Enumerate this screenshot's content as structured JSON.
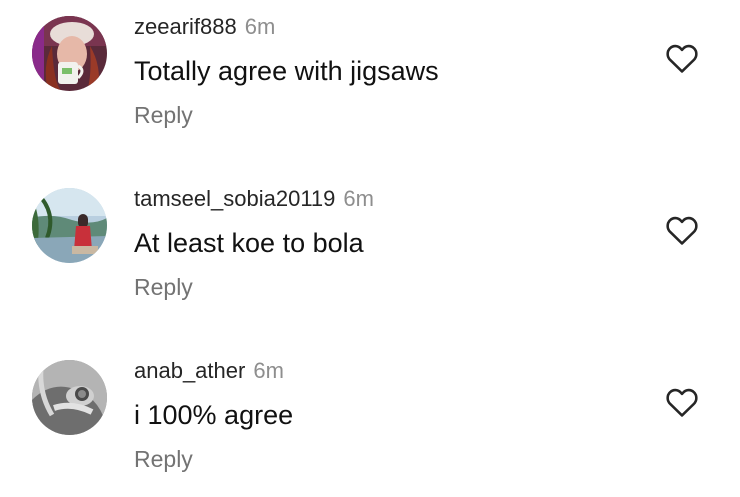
{
  "comments": [
    {
      "username": "zeearif888",
      "time": "6m",
      "text": "Totally agree with jigsaws",
      "reply_label": "Reply",
      "avatar_icon": "profile-photo-woman-with-mug",
      "like_icon": "heart-outline-icon"
    },
    {
      "username": "tamseel_sobia20119",
      "time": "6m",
      "text": "At least koe to bola",
      "reply_label": "Reply",
      "avatar_icon": "profile-photo-person-by-river",
      "like_icon": "heart-outline-icon"
    },
    {
      "username": "anab_ather",
      "time": "6m",
      "text": "i 100% agree",
      "reply_label": "Reply",
      "avatar_icon": "profile-photo-hand-with-ring",
      "like_icon": "heart-outline-icon"
    }
  ],
  "colors": {
    "username": "#262626",
    "time": "#8e8e8e",
    "text": "#111111",
    "reply": "#737373",
    "icon": "#262626"
  }
}
